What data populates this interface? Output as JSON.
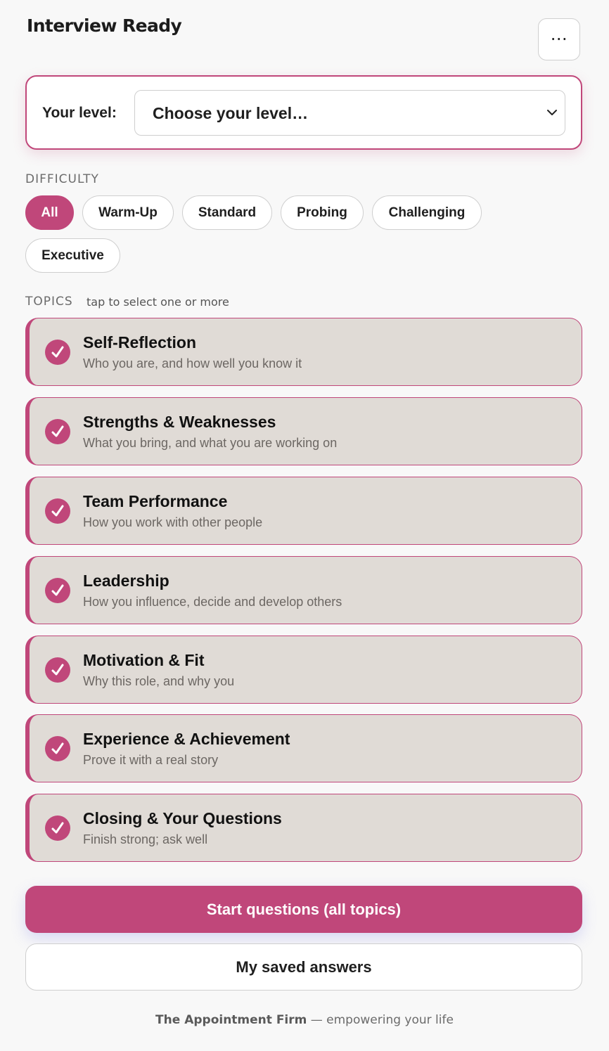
{
  "header": {
    "title": "Interview Ready",
    "menu_label": "⋯"
  },
  "level": {
    "label": "Your level:",
    "selected": "Choose your level…"
  },
  "difficulty": {
    "label": "DIFFICULTY",
    "options": [
      {
        "label": "All",
        "active": true
      },
      {
        "label": "Warm-Up",
        "active": false
      },
      {
        "label": "Standard",
        "active": false
      },
      {
        "label": "Probing",
        "active": false
      },
      {
        "label": "Challenging",
        "active": false
      },
      {
        "label": "Executive",
        "active": false
      }
    ]
  },
  "topics": {
    "label": "TOPICS",
    "hint": "tap to select one or more",
    "items": [
      {
        "title": "Self-Reflection",
        "subtitle": "Who you are, and how well you know it",
        "selected": true
      },
      {
        "title": "Strengths & Weaknesses",
        "subtitle": "What you bring, and what you are working on",
        "selected": true
      },
      {
        "title": "Team Performance",
        "subtitle": "How you work with other people",
        "selected": true
      },
      {
        "title": "Leadership",
        "subtitle": "How you influence, decide and develop others",
        "selected": true
      },
      {
        "title": "Motivation & Fit",
        "subtitle": "Why this role, and why you",
        "selected": true
      },
      {
        "title": "Experience & Achievement",
        "subtitle": "Prove it with a real story",
        "selected": true
      },
      {
        "title": "Closing & Your Questions",
        "subtitle": "Finish strong; ask well",
        "selected": true
      }
    ]
  },
  "actions": {
    "start_label": "Start questions (all topics)",
    "saved_label": "My saved answers"
  },
  "footer": {
    "brand": "The Appointment Firm",
    "tagline": " — empowering your life"
  },
  "colors": {
    "accent": "#c0477a",
    "topic_bg": "#e0dbd6",
    "page_bg": "#f8f8f8"
  }
}
